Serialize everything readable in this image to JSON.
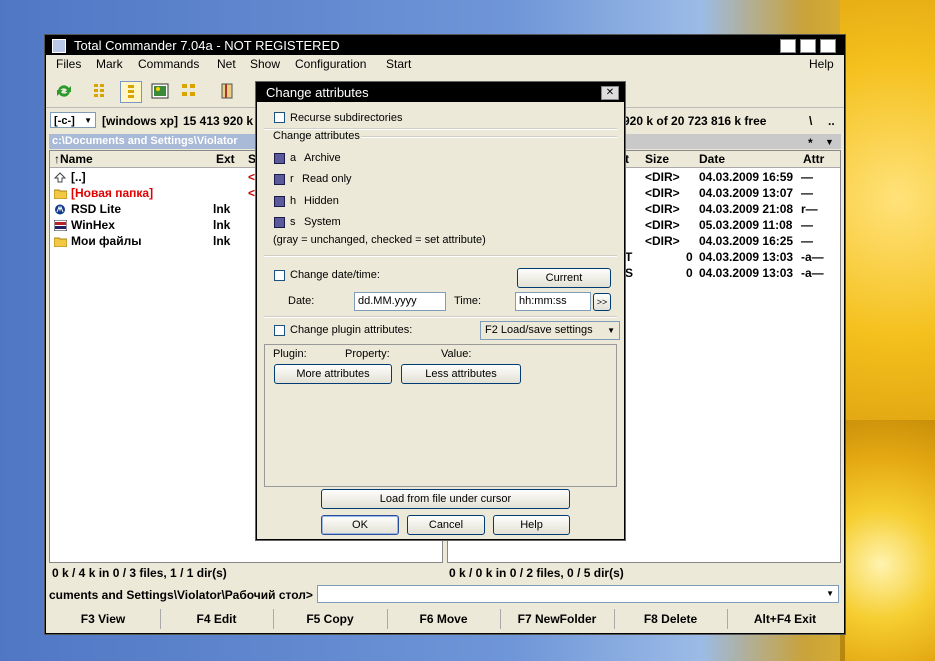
{
  "window": {
    "title": "Total Commander 7.04a - NOT REGISTERED",
    "menu": [
      "Files",
      "Mark",
      "Commands",
      "Net",
      "Show",
      "Configuration",
      "Start",
      "Help"
    ]
  },
  "toolbar": {
    "icons": [
      "refresh-icon",
      "brief-view-icon",
      "full-view-icon",
      "thumbnail-view-icon",
      "tree-icon",
      "pack-icon"
    ]
  },
  "left_panel": {
    "drive": "[-c-]",
    "volume": "[windows xp]",
    "free": "15 413 920 k",
    "path": "c:\\Documents and Settings\\Violator",
    "columns": {
      "name": "↑Name",
      "ext": "Ext",
      "size": "Si"
    },
    "rows": [
      {
        "name": "[..]",
        "ext": "",
        "size": "<D"
      },
      {
        "name": "[Новая папка]",
        "ext": "",
        "size": "<D"
      },
      {
        "name": "RSD Lite",
        "ext": "lnk",
        "size": ""
      },
      {
        "name": "WinHex",
        "ext": "lnk",
        "size": ""
      },
      {
        "name": "Мои файлы",
        "ext": "lnk",
        "size": ""
      }
    ],
    "status": "0 k / 4 k in 0 / 3 files, 1 / 1 dir(s)"
  },
  "right_panel": {
    "free": "920 k of 20 723 816 k free",
    "root": "\\",
    "up": "..",
    "filter": "*",
    "columns": {
      "ext": "t",
      "size": "Size",
      "date": "Date",
      "attr": "Attr"
    },
    "rows": [
      {
        "ext": "",
        "size": "<DIR>",
        "date": "04.03.2009 16:59",
        "attr": "—"
      },
      {
        "ext": "",
        "size": "<DIR>",
        "date": "04.03.2009 13:07",
        "attr": "—"
      },
      {
        "ext": "",
        "size": "<DIR>",
        "date": "04.03.2009 21:08",
        "attr": "r—"
      },
      {
        "ext": "",
        "size": "<DIR>",
        "date": "05.03.2009 11:08",
        "attr": "—"
      },
      {
        "ext": "",
        "size": "<DIR>",
        "date": "04.03.2009 16:25",
        "attr": "—"
      },
      {
        "ext": "T",
        "size": "0",
        "date": "04.03.2009 13:03",
        "attr": "-a—"
      },
      {
        "ext": "S",
        "size": "0",
        "date": "04.03.2009 13:03",
        "attr": "-a—"
      }
    ],
    "status": "0 k / 0 k in 0 / 2 files, 0 / 5 dir(s)"
  },
  "cmdline": {
    "label": "cuments and Settings\\Violator\\Рабочий стол>"
  },
  "fkeys": [
    "F3 View",
    "F4 Edit",
    "F5 Copy",
    "F6 Move",
    "F7 NewFolder",
    "F8 Delete",
    "Alt+F4 Exit"
  ],
  "dialog": {
    "title": "Change attributes",
    "recurse": "Recurse subdirectories",
    "group_label": "Change attributes",
    "attrs": [
      {
        "key": "a",
        "label": "Archive"
      },
      {
        "key": "r",
        "label": "Read only"
      },
      {
        "key": "h",
        "label": "Hidden"
      },
      {
        "key": "s",
        "label": "System"
      }
    ],
    "hint": "(gray = unchanged, checked = set attribute)",
    "change_date": "Change date/time:",
    "current_btn": "Current",
    "date_label": "Date:",
    "date_value": "dd.MM.yyyy",
    "time_label": "Time:",
    "time_value": "hh:mm:ss",
    "more_btn": ">>",
    "plugin_attrs": "Change plugin attributes:",
    "plugin_select": "F2 Load/save settings",
    "col_plugin": "Plugin:",
    "col_property": "Property:",
    "col_value": "Value:",
    "more_attrs": "More attributes",
    "less_attrs": "Less attributes",
    "load_btn": "Load from file under cursor",
    "ok": "OK",
    "cancel": "Cancel",
    "help": "Help"
  }
}
